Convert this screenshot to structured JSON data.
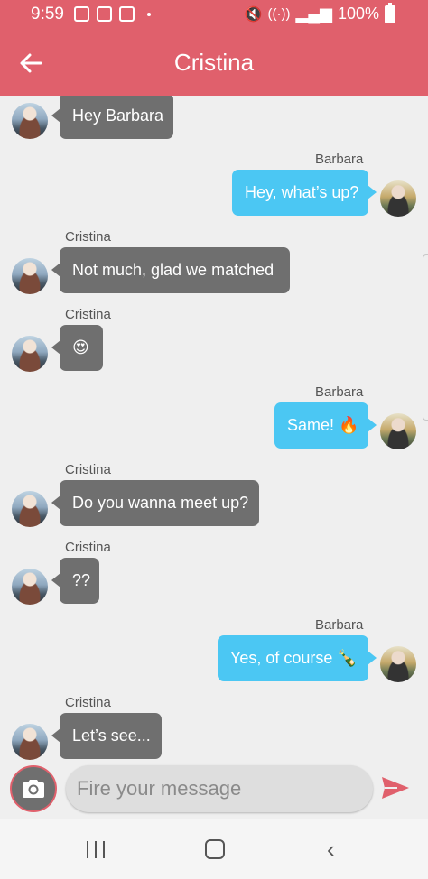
{
  "status_bar": {
    "time": "9:59",
    "battery": "100%"
  },
  "header": {
    "title": "Cristina"
  },
  "messages": [
    {
      "sender": "",
      "text": "Hey Barbara",
      "direction": "in"
    },
    {
      "sender": "Barbara",
      "text": "Hey, what’s up?",
      "direction": "out"
    },
    {
      "sender": "Cristina",
      "text": "Not much, glad we matched",
      "direction": "in"
    },
    {
      "sender": "Cristina",
      "text": "😍",
      "direction": "in"
    },
    {
      "sender": "Barbara",
      "text": "Same! 🔥",
      "direction": "out"
    },
    {
      "sender": "Cristina",
      "text": "Do you wanna meet up?",
      "direction": "in"
    },
    {
      "sender": "Cristina",
      "text": "??",
      "direction": "in"
    },
    {
      "sender": "Barbara",
      "text": "Yes, of course 🍾",
      "direction": "out"
    },
    {
      "sender": "Cristina",
      "text": "Let’s see...",
      "direction": "in"
    }
  ],
  "composer": {
    "placeholder": "Fire your message"
  },
  "colors": {
    "accent": "#e0606c",
    "incoming_bubble": "#6f6f6f",
    "outgoing_bubble": "#4bc7f3",
    "background": "#efefef"
  },
  "icons": {
    "back": "arrow-left-icon",
    "camera": "camera-icon",
    "send": "send-icon"
  }
}
